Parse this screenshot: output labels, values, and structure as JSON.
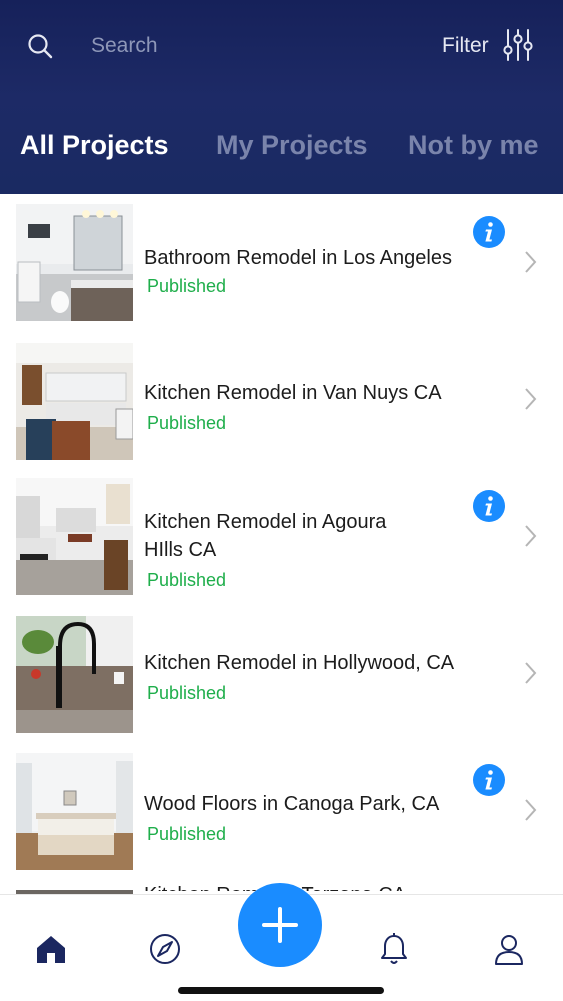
{
  "search": {
    "placeholder": "Search"
  },
  "filter": {
    "label": "Filter"
  },
  "tabs": [
    {
      "label": "All Projects",
      "active": true
    },
    {
      "label": "My Projects",
      "active": false
    },
    {
      "label": "Not by me",
      "active": false
    }
  ],
  "projects": [
    {
      "title_line1": "Bathroom Remodel in Los Angeles",
      "title_line2": "",
      "status": "Published",
      "has_info": true
    },
    {
      "title_line1": "Kitchen Remodel in Van Nuys CA",
      "title_line2": "",
      "status": "Published",
      "has_info": false
    },
    {
      "title_line1": "Kitchen Remodel in Agoura",
      "title_line2": "HIlls CA",
      "status": "Published",
      "has_info": true
    },
    {
      "title_line1": "Kitchen Remodel in Hollywood, CA",
      "title_line2": "",
      "status": "Published",
      "has_info": false
    },
    {
      "title_line1": "Wood Floors in Canoga Park, CA",
      "title_line2": "",
      "status": "Published",
      "has_info": true
    },
    {
      "title_line1": "Kitchen Remodel Tarzana CA",
      "title_line2": "",
      "status": "",
      "has_info": false
    }
  ],
  "tabbar": {
    "items": [
      "home-icon",
      "compass-icon",
      "add-icon",
      "bell-icon",
      "profile-icon"
    ],
    "active": "home-icon"
  },
  "colors": {
    "header": "#1b2760",
    "accent": "#1a8cff",
    "published": "#1fae4b",
    "tab_inactive": "#7a84ab"
  }
}
